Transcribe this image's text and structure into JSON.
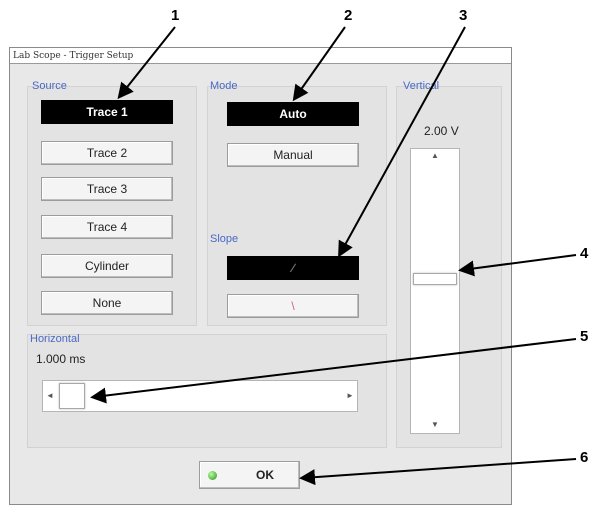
{
  "window": {
    "title": "Lab Scope - Trigger Setup"
  },
  "source": {
    "label": "Source",
    "buttons": [
      "Trace 1",
      "Trace 2",
      "Trace 3",
      "Trace 4",
      "Cylinder",
      "None"
    ],
    "selected": "Trace 1"
  },
  "mode": {
    "label": "Mode",
    "buttons": [
      "Auto",
      "Manual"
    ],
    "selected": "Auto"
  },
  "slope": {
    "label": "Slope",
    "rising_glyph": "∕",
    "falling_glyph": "\\",
    "selected": "rising"
  },
  "vertical": {
    "label": "Vertical",
    "value": "2.00 V",
    "up_arrow": "▲",
    "down_arrow": "▼"
  },
  "horizontal": {
    "label": "Horizontal",
    "value": "1.000 ms",
    "left_arrow": "◄",
    "right_arrow": "►"
  },
  "ok_button": {
    "label": "OK",
    "led_color": "#3aa52a"
  },
  "callouts": [
    "1",
    "2",
    "3",
    "4",
    "5",
    "6"
  ]
}
